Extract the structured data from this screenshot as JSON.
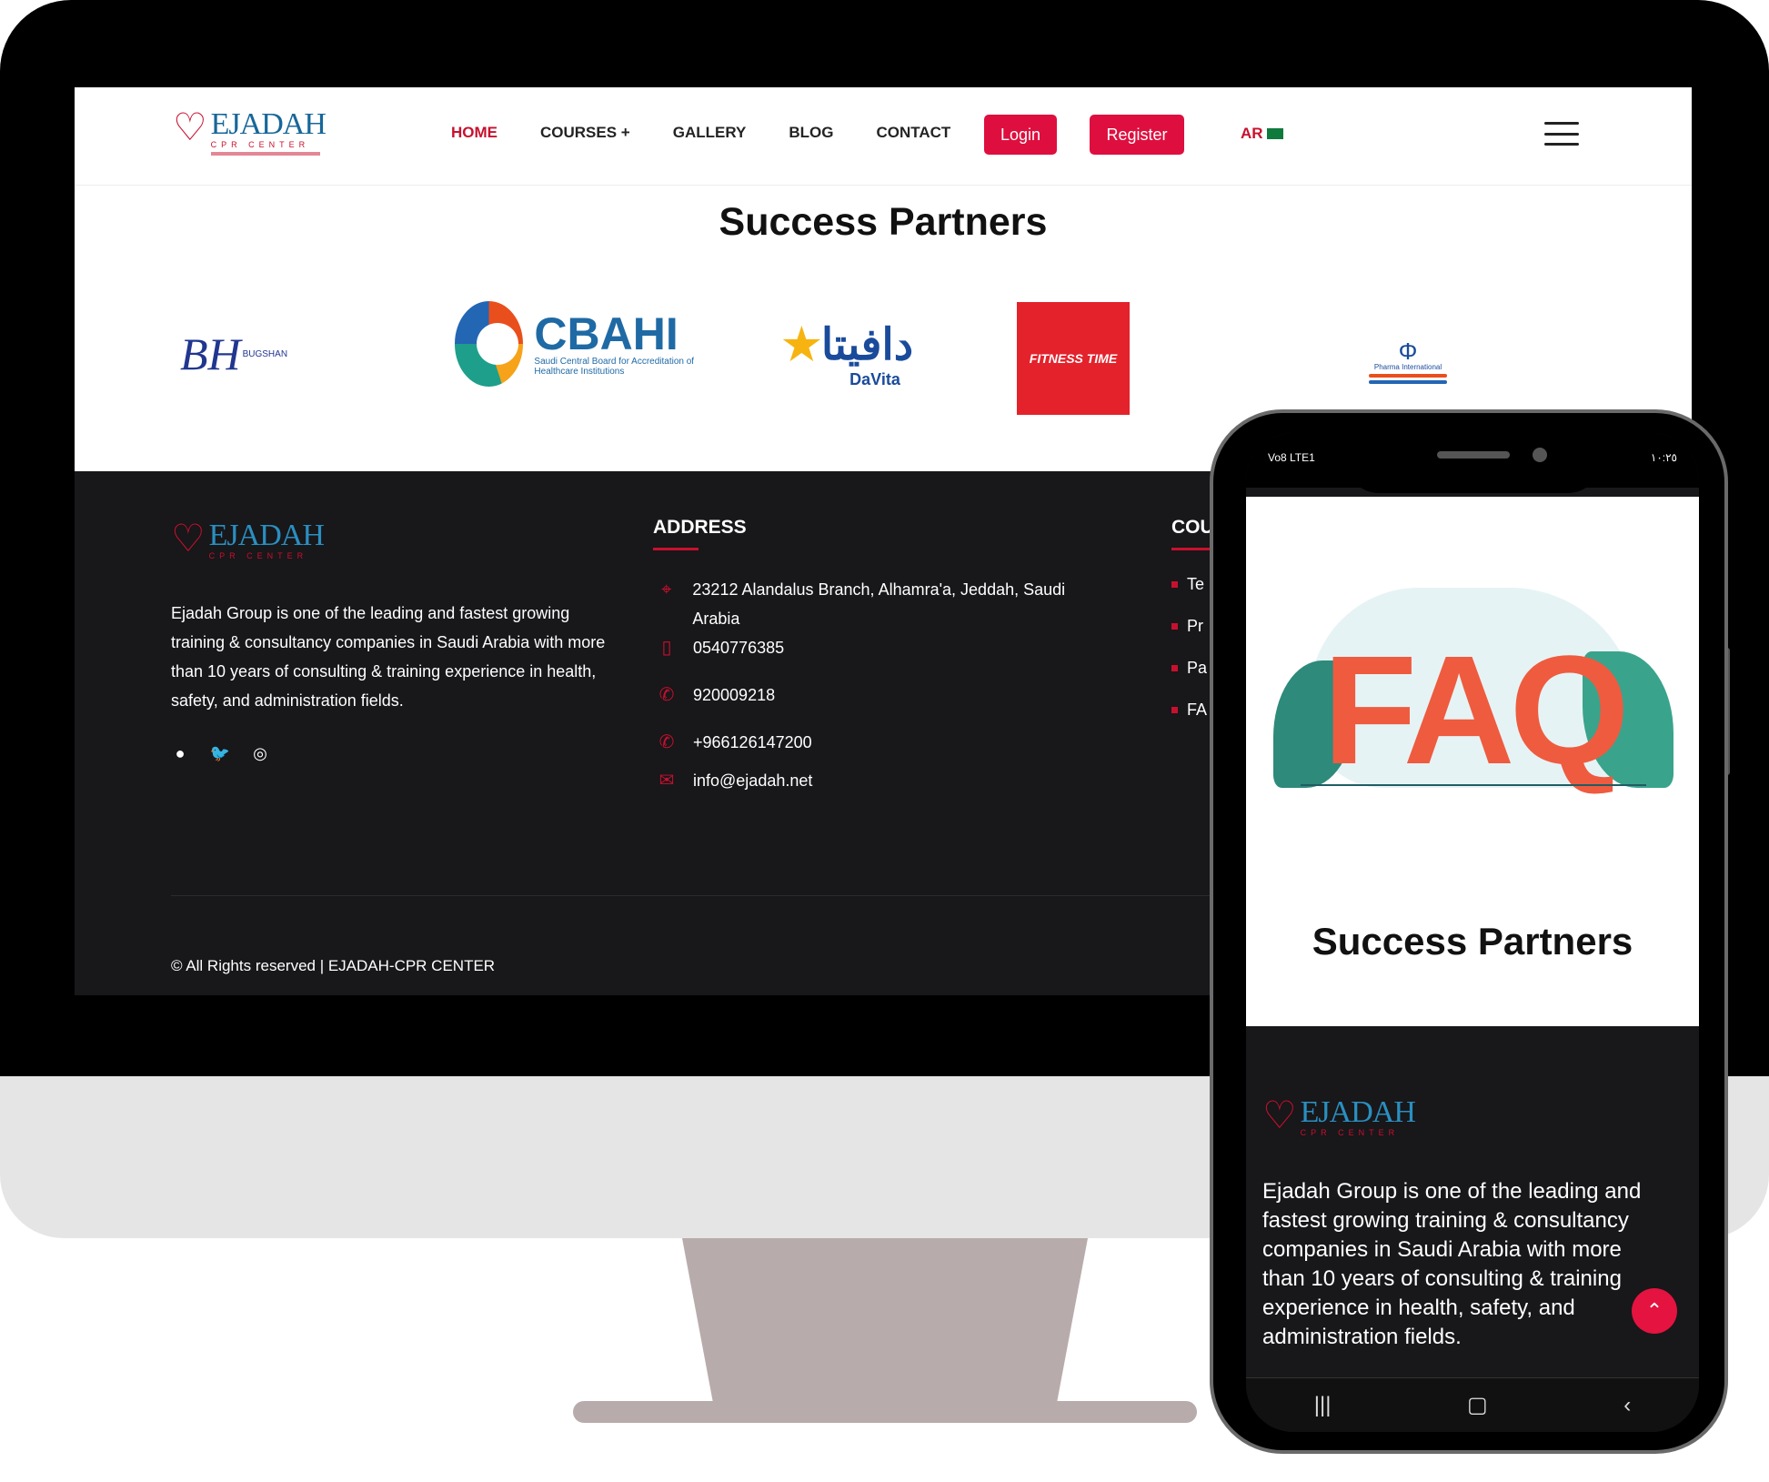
{
  "brand": {
    "name": "EJADAH",
    "sub": "CPR CENTER"
  },
  "nav": {
    "items": [
      "HOME",
      "COURSES +",
      "GALLERY",
      "BLOG",
      "CONTACT"
    ],
    "login": "Login",
    "register": "Register",
    "lang": "AR"
  },
  "partners": {
    "title": "Success Partners",
    "bh": {
      "mark": "BH",
      "name": "BUGSHAN"
    },
    "cbahi": {
      "name": "CBAHI",
      "en": "Saudi Central Board for Accreditation of Healthcare Institutions"
    },
    "davita": {
      "ar": "دافيتا",
      "en": "DaVita"
    },
    "fitness": {
      "name": "FITNESS TIME"
    },
    "pharma": {
      "name": "Pharma International"
    }
  },
  "footer": {
    "about": "Ejadah Group is one of the leading and fastest growing training & consultancy companies in Saudi Arabia with more than 10 years of consulting & training experience in health, safety, and administration fields.",
    "address_heading": "ADDRESS",
    "courses_heading": "COU",
    "address": "23212 Alandalus Branch, Alhamra'a, Jeddah, Saudi Arabia",
    "phone1": "0540776385",
    "phone2": "920009218",
    "phone3": "+966126147200",
    "email": "info@ejadah.net",
    "courses": [
      "Te",
      "Pr",
      "Pa",
      "FA"
    ],
    "copyright": "© All Rights reserved | EJADAH-CPR CENTER"
  },
  "phone": {
    "status_left": "Vo8 LTE1",
    "status_right": "١٠:٢٥",
    "faq": "FAQ",
    "success_title": "Success Partners",
    "about": "Ejadah Group is one of the leading and fastest growing training & consultancy companies in Saudi Arabia with more than 10 years of consulting & training experience in health, safety, and administration fields."
  },
  "colors": {
    "accent": "#c8102e",
    "button": "#de0f3f",
    "brand_blue": "#17679a",
    "footer_bg": "#18171a"
  }
}
